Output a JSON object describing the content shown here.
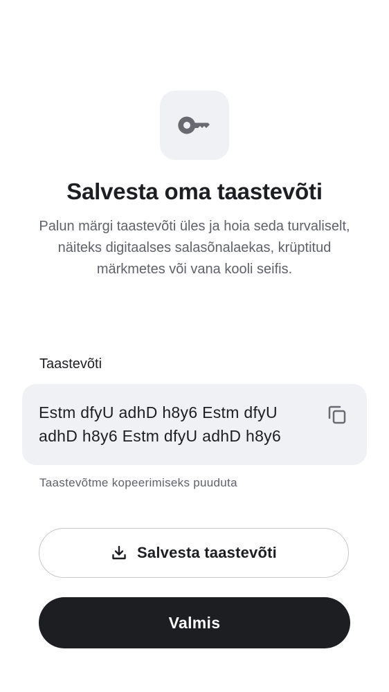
{
  "header": {
    "icon": "key-icon",
    "title": "Salvesta oma taastevõti",
    "description": "Palun märgi taastevõti üles ja hoia seda turvaliselt, näiteks digitaalses salasõnalaekas, krüptitud märkmetes või vana kooli seifis."
  },
  "recovery_key": {
    "label": "Taastevõti",
    "value": "Estm dfyU adhD h8y6 Estm dfyU adhD h8y6 Estm dfyU adhD h8y6",
    "copy_icon": "copy-icon",
    "hint": "Taastevõtme kopeerimiseks puuduta"
  },
  "actions": {
    "save_label": "Salvesta taastevõti",
    "save_icon": "download-icon",
    "done_label": "Valmis"
  },
  "colors": {
    "primary": "#1d1e22",
    "tile_bg": "#eff1f4",
    "secondary_text": "#5f6268",
    "outline": "#c6c7cb"
  }
}
